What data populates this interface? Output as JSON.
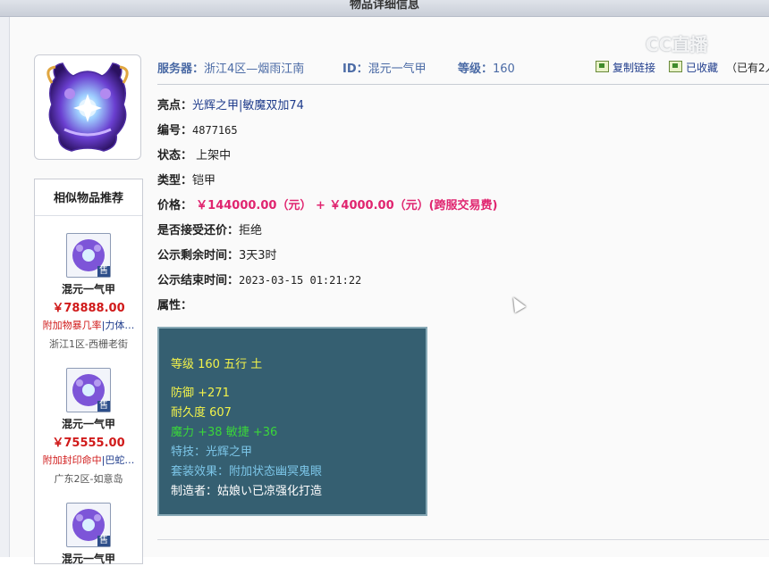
{
  "page": {
    "title": "物品详细信息"
  },
  "watermark": "CC直播",
  "header": {
    "server_label": "服务器：",
    "server_value": "浙江4区—烟雨江南",
    "id_label": "ID：",
    "id_value": "混元一气甲",
    "level_label": "等级：",
    "level_value": "160",
    "copy_link": "复制链接",
    "collected": "已收藏",
    "collect_count": "（已有2人"
  },
  "details": {
    "highlight_label": "亮点：",
    "highlight_value": "光辉之甲|敏魔双加74",
    "number_label": "编号：",
    "number_value": "4877165",
    "status_label": "状态：",
    "status_value": "上架中",
    "type_label": "类型：",
    "type_value": "铠甲",
    "price_label": "价格：",
    "price_value": "￥144000.00（元） + ￥4000.00（元）(跨服交易费)",
    "counter_label": "是否接受还价：",
    "counter_value": "拒绝",
    "remaining_label": "公示剩余时间：",
    "remaining_value": "3天3时",
    "end_label": "公示结束时间：",
    "end_value": "2023-03-15 01:21:22",
    "attr_label": "属性："
  },
  "attributes": {
    "line1": "等级 160 五行 土",
    "defense": "防御 +271",
    "durability": "耐久度 607",
    "magic": "魔力 +38 敏捷 +36",
    "skill": "特技：光辉之甲",
    "set": "套装效果：附加状态幽冥鬼眼",
    "maker": "制造者：姑娘い已凉强化打造"
  },
  "similar": {
    "title": "相似物品推荐",
    "sold_tag": "售",
    "items": [
      {
        "name": "混元一气甲",
        "price": "￥78888.00",
        "desc_red": "附加物暴几率",
        "desc_blue": "|力体…",
        "server": "浙江1区-西栅老街"
      },
      {
        "name": "混元一气甲",
        "price": "￥75555.00",
        "desc_red": "附加封印命中",
        "desc_blue": "|巴蛇…",
        "server": "广东2区-如意岛"
      },
      {
        "name": "混元一气甲",
        "price": "",
        "desc_red": "",
        "desc_blue": "",
        "server": ""
      }
    ]
  }
}
